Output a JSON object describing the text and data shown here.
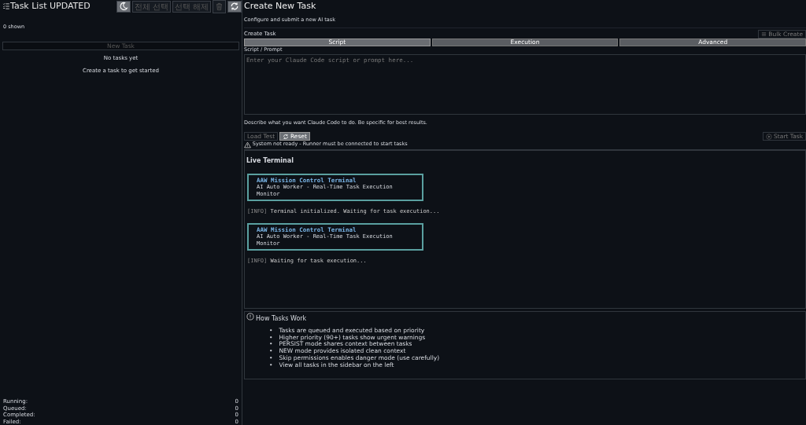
{
  "sidebar": {
    "title": "Task List UPDATED",
    "toolbar": [
      {
        "kind": "theme"
      },
      {
        "kind": "text",
        "label": "전체 선택",
        "disabled": true
      },
      {
        "kind": "text",
        "label": "선택 해제",
        "disabled": true
      },
      {
        "kind": "delete",
        "disabled": true
      },
      {
        "kind": "refresh"
      }
    ],
    "count": "0 shown",
    "new_task": {
      "label": "New Task",
      "disabled": true
    },
    "empty_title": "No tasks yet",
    "empty_hint": "Create a task to get started",
    "stats": [
      {
        "label": "Running:",
        "value": "0"
      },
      {
        "label": "Queued:",
        "value": "0"
      },
      {
        "label": "Completed:",
        "value": "0"
      },
      {
        "label": "Failed:",
        "value": "0"
      }
    ]
  },
  "main": {
    "title": "Create New Task",
    "subtitle": "Configure and submit a new AI task",
    "section": "Create Task",
    "bulk_create": {
      "label": "Bulk Create",
      "disabled": true
    },
    "tabs": [
      {
        "label": "Script",
        "selected": true
      },
      {
        "label": "Execution",
        "selected": false
      },
      {
        "label": "Advanced",
        "selected": false
      }
    ],
    "prompt_label": "Script / Prompt",
    "prompt_placeholder": "Enter your Claude Code script or prompt here...",
    "prompt_hint": "Describe what you want Claude Code to do. Be specific for best results.",
    "load_test": {
      "label": "Load Test",
      "disabled": true
    },
    "reset": {
      "label": "Reset",
      "disabled": false
    },
    "start_task": {
      "label": "Start Task",
      "disabled": true
    },
    "warning": "System not ready - Runner must be connected to start tasks",
    "terminal": {
      "title": "Live Terminal",
      "lines": [
        {
          "kind": "banner",
          "title": "AAW Mission Control Terminal",
          "subtitle": "AI Auto Worker - Real-Time Task Execution Monitor"
        },
        {
          "kind": "log",
          "tag": "[INFO]",
          "text": "Terminal initialized. Waiting for task execution..."
        },
        {
          "kind": "banner",
          "title": "AAW Mission Control Terminal",
          "subtitle": "AI Auto Worker - Real-Time Task Execution Monitor"
        },
        {
          "kind": "log",
          "tag": "[INFO]",
          "text": "Waiting for task execution..."
        }
      ]
    },
    "help": {
      "title": "How Tasks Work",
      "items": [
        {
          "marker": "•",
          "text": "Tasks are queued and executed based on priority"
        },
        {
          "marker": "•",
          "text": "Higher priority (90+) tasks show urgent warnings"
        },
        {
          "marker": "•",
          "text": "PERSIST mode shares context between tasks"
        },
        {
          "marker": "•",
          "text": "NEW mode provides isolated clean context"
        },
        {
          "marker": "•",
          "text": "Skip permissions enables danger mode (use carefully)"
        },
        {
          "marker": "•",
          "text": "View all tasks in the sidebar on the left"
        }
      ]
    }
  }
}
